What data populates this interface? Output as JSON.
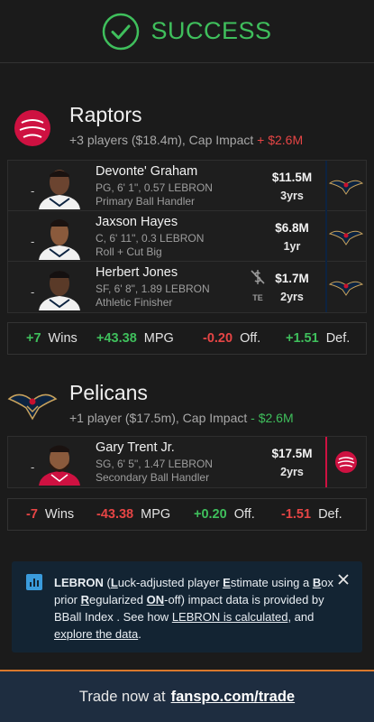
{
  "header": {
    "status_text": "SUCCESS",
    "icon": "check-circle-icon"
  },
  "teams": [
    {
      "name": "Raptors",
      "summary": "+3 players ($18.4m), Cap Impact",
      "cap_impact": "+ $2.6M",
      "players": [
        {
          "name": "Devonte' Graham",
          "info": "PG, 6' 1\", 0.57 LEBRON",
          "role": "Primary Ball Handler",
          "salary": "$11.5M",
          "years": "3yrs",
          "from_team": "Pelicans"
        },
        {
          "name": "Jaxson Hayes",
          "info": "C, 6' 11\", 0.3 LEBRON",
          "role": "Roll + Cut Big",
          "salary": "$6.8M",
          "years": "1yr",
          "from_team": "Pelicans"
        },
        {
          "name": "Herbert Jones",
          "info": "SF, 6' 8\", 1.89 LEBRON",
          "role": "Athletic Finisher",
          "salary": "$1.7M",
          "years": "2yrs",
          "from_team": "Pelicans",
          "badge": "TE"
        }
      ],
      "stats": {
        "wins": "+7",
        "wins_label": "Wins",
        "mpg": "+43.38",
        "mpg_label": "MPG",
        "off": "-0.20",
        "off_label": "Off.",
        "def": "+1.51",
        "def_label": "Def."
      }
    },
    {
      "name": "Pelicans",
      "summary": "+1 player ($17.5m), Cap Impact",
      "cap_impact": "- $2.6M",
      "players": [
        {
          "name": "Gary Trent Jr.",
          "info": "SG, 6' 5\", 1.47 LEBRON",
          "role": "Secondary Ball Handler",
          "salary": "$17.5M",
          "years": "2yrs",
          "from_team": "Raptors"
        }
      ],
      "stats": {
        "wins": "-7",
        "wins_label": "Wins",
        "mpg": "-43.38",
        "mpg_label": "MPG",
        "off": "+0.20",
        "off_label": "Off.",
        "def": "-1.51",
        "def_label": "Def."
      }
    }
  ],
  "info": {
    "lebron": "LEBRON",
    "L": "L",
    "uck": "uck-adjusted player ",
    "E": "E",
    "stimate": "stimate using a ",
    "B": "B",
    "ox": "ox prior ",
    "R": "R",
    "egularized": "egularized ",
    "ON": "ON",
    "off": "-off) impact data is provided by BBall Index . See how ",
    "link1": "LEBRON is calculated",
    "and": ", and ",
    "link2": "explore the data",
    "end": "."
  },
  "footer": {
    "prefix": "Trade now at",
    "link": "fanspo.com/trade"
  },
  "colors": {
    "success": "#3fbf5c",
    "negative": "#e64545",
    "raptors_red": "#ce1141",
    "pelicans_navy": "#0c2340",
    "pelicans_gold": "#c8a25c",
    "footer_accent": "#d9782c"
  }
}
